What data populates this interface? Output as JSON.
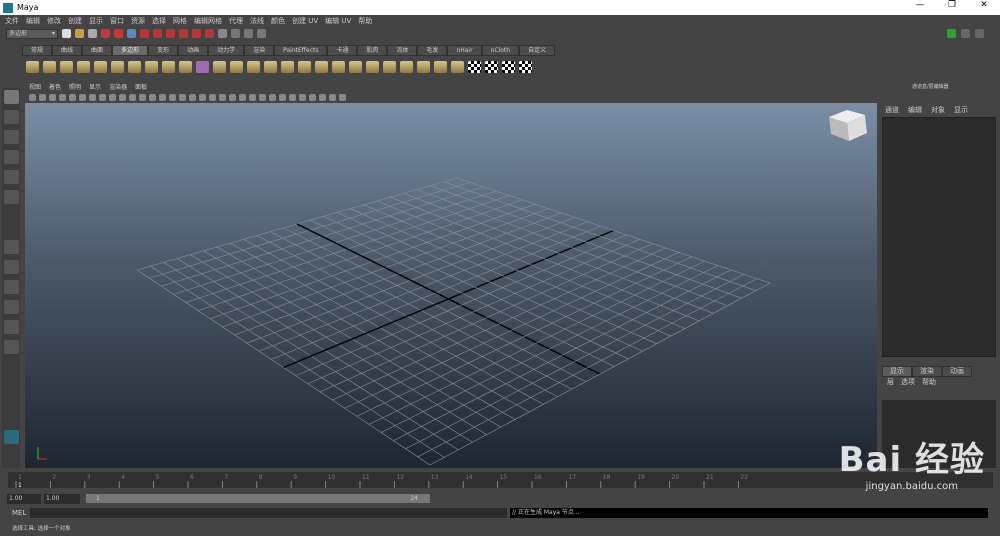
{
  "window": {
    "title": "Maya",
    "controls": [
      "—",
      "❐",
      "✕"
    ]
  },
  "menu": [
    "文件",
    "编辑",
    "修改",
    "创建",
    "显示",
    "窗口",
    "资源",
    "选择",
    "网格",
    "编辑网格",
    "代理",
    "法线",
    "颜色",
    "创建 UV",
    "编辑 UV",
    "帮助"
  ],
  "mode_select": "多边形",
  "shelf_tabs": [
    "常规",
    "曲线",
    "曲面",
    "多边形",
    "变形",
    "动画",
    "动力学",
    "渲染",
    "PaintEffects",
    "卡通",
    "肌肉",
    "流体",
    "毛发",
    "nHair",
    "nCloth",
    "自定义"
  ],
  "active_shelf": "多边形",
  "panel_menu": [
    "视图",
    "着色",
    "照明",
    "显示",
    "渲染器",
    "面板"
  ],
  "right_panel": {
    "title": "通道盒/层编辑器",
    "menu": [
      "通道",
      "编辑",
      "对象",
      "显示"
    ],
    "tabs": [
      "显示",
      "渲染",
      "动画"
    ],
    "menu2": [
      "层",
      "选项",
      "帮助"
    ]
  },
  "timeline": {
    "ticks": [
      "1",
      "2",
      "3",
      "4",
      "5",
      "6",
      "7",
      "8",
      "9",
      "10",
      "11",
      "12",
      "13",
      "14",
      "15",
      "16",
      "17",
      "18",
      "19",
      "20",
      "21",
      "22"
    ],
    "current": "1"
  },
  "range": {
    "start": "1.00",
    "anim_start": "1.00",
    "slider_start": "1",
    "slider_end": "24"
  },
  "command": {
    "label": "MEL",
    "output": "// 正在生成 Maya 节点..."
  },
  "status": "选择工具: 选择一个对象",
  "watermark": {
    "text": "Bai 经验",
    "url": "jingyan.baidu.com"
  }
}
